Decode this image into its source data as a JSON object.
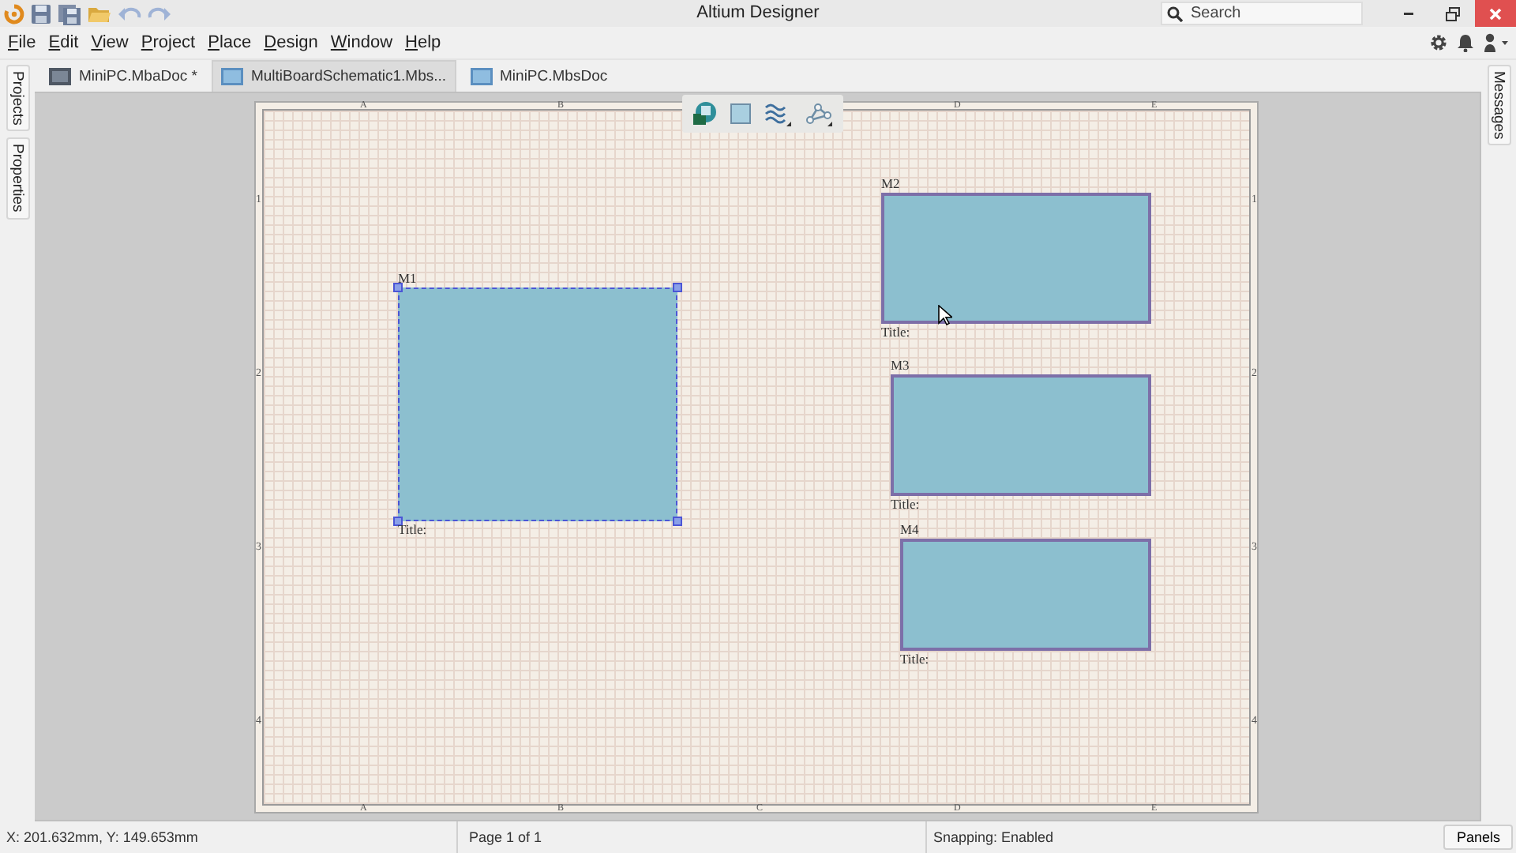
{
  "title_bar": {
    "title": "Altium Designer",
    "search": {
      "placeholder": "Search"
    }
  },
  "menu": [
    "File",
    "Edit",
    "View",
    "Project",
    "Place",
    "Design",
    "Window",
    "Help"
  ],
  "document_tabs": [
    {
      "label": "MiniPC.MbaDoc *",
      "selected": false,
      "kind": "project"
    },
    {
      "label": "MultiBoardSchematic1.Mbs...",
      "selected": true,
      "kind": "schematic"
    },
    {
      "label": "MiniPC.MbsDoc",
      "selected": false,
      "kind": "schematic"
    }
  ],
  "left_panels": [
    "Projects",
    "Properties"
  ],
  "right_panels": [
    "Messages"
  ],
  "sheet": {
    "top_zones": [
      "A",
      "B",
      "D",
      "E"
    ],
    "bottom_zones": [
      "A",
      "B",
      "C",
      "D",
      "E"
    ],
    "left_zones": [
      "1",
      "2",
      "3",
      "4"
    ],
    "right_zones": [
      "1",
      "2",
      "3",
      "4"
    ],
    "modules": [
      {
        "designator": "M1",
        "title": "Title:",
        "selected": true
      },
      {
        "designator": "M2",
        "title": "Title:",
        "selected": false
      },
      {
        "designator": "M3",
        "title": "Title:",
        "selected": false
      },
      {
        "designator": "M4",
        "title": "Title:",
        "selected": false
      }
    ]
  },
  "status_bar": {
    "coordinates": "X: 201.632mm, Y: 149.653mm",
    "page": "Page 1 of 1",
    "snapping": "Snapping: Enabled",
    "panels_button": "Panels"
  }
}
